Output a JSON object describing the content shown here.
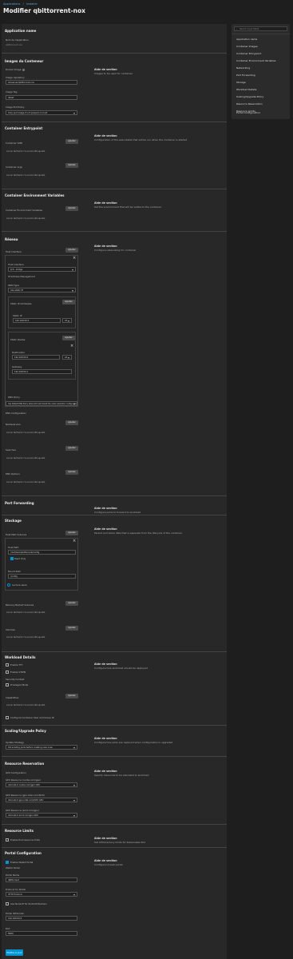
{
  "breadcrumb": {
    "part1": "Applications",
    "sep": "/",
    "part2": "Installer"
  },
  "page_title": "Modifier qbittorrent-nox",
  "nav": {
    "search_placeholder": "Search input fields",
    "items": [
      "Application name",
      "Container Images",
      "Container Entrypoint",
      "Container Environment Variables",
      "Networking",
      "Port Forwarding",
      "Storage",
      "Workload Details",
      "Scaling/Upgrade Policy",
      "Resource Reservation",
      "Resource Limits",
      "Portal Configuration"
    ]
  },
  "app_name": {
    "title": "Application name",
    "label": "Nom de l'application",
    "value": "qbittorrent-nox"
  },
  "images": {
    "title": "Images du Conteneur",
    "help_title": "Aide de section",
    "help_text": "Images to be used for container",
    "container_image_label": "Docker Image",
    "image_repo_label": "Image repository",
    "image_repo_value": "lsioserver/qbittorrent-nox",
    "image_tag_label": "Image Tag",
    "image_tag_value": "latest",
    "pull_policy_label": "Image Pull Policy",
    "pull_policy_value": "Only pull image if not present on host"
  },
  "entrypoint": {
    "title": "Container Entrypoint",
    "help_title": "Aide de section",
    "help_text": "Configuration of the executable that will be run when the container is started",
    "args_label": "Container CMD",
    "add": "Ajouter",
    "empty1": "Aucun élément n'a encore été ajouté.",
    "args2_label": "Container Args",
    "empty2": "Aucun élément n'a encore été ajouté."
  },
  "env": {
    "title": "Container Environment Variables",
    "help_title": "Aide de section",
    "help_text": "Set the environment that will be visible to the container",
    "label": "Container Environment Variables",
    "add": "Ajouter",
    "empty": "Aucun élément n'a encore été ajouté."
  },
  "networking": {
    "title": "Réseau",
    "help_title": "Aide de section",
    "help_text": "Configure networking for container",
    "host_interface_label": "Host Interface",
    "add": "Ajouter",
    "iface_label": "Host Interface",
    "iface_value": "br0 - bridge",
    "ipam_label": "IP Address Management",
    "ipam_type_label": "IPAM Type",
    "ipam_type_value": "Use static IP",
    "static_ip_label": "Static IP Addresses",
    "static_ip_add": "Ajouter",
    "static_ip_field": "Static IP",
    "static_ip_value": "192.168.50.5",
    "static_ip_suffix": "24",
    "static_routes_label": "Static Routes",
    "static_routes_add": "Ajouter",
    "dest_label": "Destination",
    "dest_value": "192.168.50.0",
    "dest_suffix": "24",
    "gateway_label": "Gateway",
    "gateway_value": "192.168.50.1",
    "dns_policy_label": "DNS Policy",
    "dns_policy_value": "Use Default DNS Policy where Pod will inherit the name resolution configuration from the node",
    "dns_config_label": "DNS Configuration",
    "nameservers_label": "Nameservers",
    "nameservers_add": "Ajouter",
    "nameservers_empty": "Aucun élément n'a encore été ajouté.",
    "searches_label": "Searches",
    "searches_add": "Ajouter",
    "searches_empty": "Aucun élément n'a encore été ajouté.",
    "dns_options_label": "DNS Options",
    "dns_options_add": "Ajouter",
    "dns_options_empty": "Aucun élément n'a encore été ajouté."
  },
  "port_forwarding": {
    "title": "Port Forwarding",
    "help_title": "Aide de section",
    "help_text": "Configure ports to forward to workload"
  },
  "storage": {
    "title": "Stockage",
    "help_title": "Aide de section",
    "help_text": "Persist and share data that is separate from the lifecycle of the container",
    "host_path_label": "Host Path Volumes",
    "add": "Ajouter",
    "host_path_field": "Host Path",
    "host_path_value": "/mnt/tank/qbittorrent/config",
    "read_only_label": "Read Only",
    "mount_path_label": "Mount Path",
    "mount_path_value": "/config",
    "read_only_check": "Lecture seule",
    "memory_backed_label": "Memory Backed Volumes",
    "memory_add": "Ajouter",
    "memory_empty": "Aucun élément n'a encore été ajouté.",
    "volumes_label": "Volumes",
    "volumes_add": "Ajouter",
    "volumes_empty": "Aucun élément n'a encore été ajouté."
  },
  "workload": {
    "title": "Workload Details",
    "help_title": "Aide de section",
    "help_text": "Configure how workload should be deployed",
    "tty_label": "Enable TTY",
    "stdin_label": "Enable STDIN",
    "security_label": "Security Context",
    "privileged_label": "Privileged Mode",
    "capabilities_label": "Capabilities",
    "cap_add": "Ajouter",
    "cap_empty": "Aucun élément n'a encore été ajouté.",
    "container_user_label": "Configure Container User and Group ID"
  },
  "scaling": {
    "title": "Scaling/Upgrade Policy",
    "help_title": "Aide de section",
    "help_text": "Configure how pods are replaced when configuration is upgraded",
    "strategy_label": "Update Strategy",
    "strategy_value": "Kill existing pods before creating new ones"
  },
  "reservation": {
    "title": "Resource Reservation",
    "help_title": "Aide de section",
    "help_text": "Specify resources to be allocated to workload",
    "gpu_label": "GPU Configuration",
    "gpu1_label": "GPU Resource (nvidia.com/gpu)",
    "gpu1_value": "Allocate 0 nvidia.com/gpu GPU",
    "gpu2_label": "GPU Resource (gpu.intel.com/i915)",
    "gpu2_value": "Allocate 0 gpu.intel.com/i915 GPU",
    "gpu3_label": "GPU Resource (amd.com/gpu)",
    "gpu3_value": "Allocate 0 amd.com/gpu GPU"
  },
  "limits": {
    "title": "Resource Limits",
    "help_title": "Aide de section",
    "help_text": "Set CPU/memory limits for Kubernetes Pod",
    "enable_label": "Enable Pod resource limits"
  },
  "portal": {
    "title": "Portal Configuration",
    "help_title": "Aide de section",
    "help_text": "Configure UI web portal",
    "enable_label": "Enable WebUI Portal",
    "webui_label": "WebUI Portal",
    "portal_name_label": "Portal Name",
    "portal_name_value": "qBittorrent",
    "protocol_label": "Protocol for Portal",
    "protocol_value": "HTTP Protocol",
    "node_ip_label": "Use Node IP for Portal IP/Domain",
    "domain_label": "Portal IP/Domain",
    "domain_value": "192.168.50.5",
    "port_label": "Port",
    "port_value": "8080"
  },
  "save_label": "Mettre à Jour"
}
